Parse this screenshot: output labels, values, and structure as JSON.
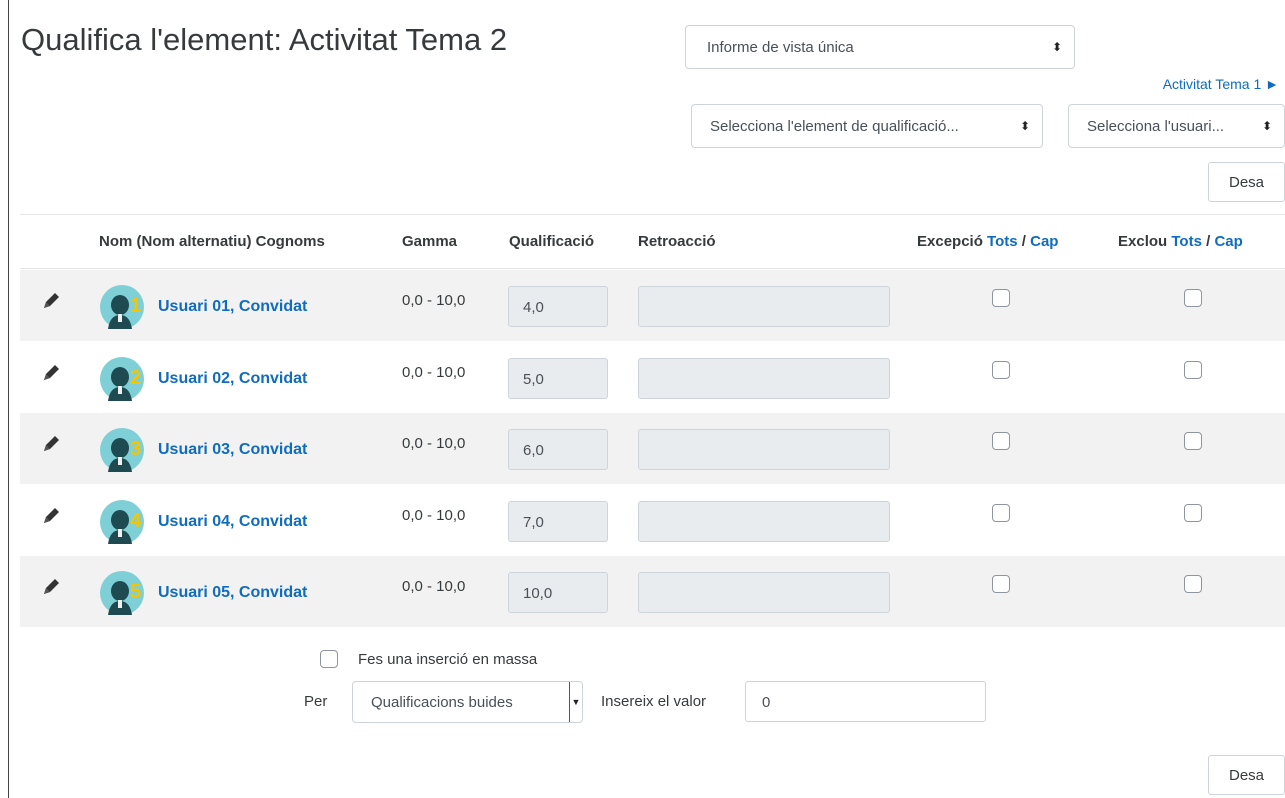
{
  "page": {
    "title": "Qualifica l'element: Activitat Tema 2"
  },
  "report_select": {
    "value": "Informe de vista única"
  },
  "next_item_link": {
    "label": "Activitat Tema 1 ►"
  },
  "item_select": {
    "value": "Selecciona l'element de qualificació..."
  },
  "user_select": {
    "value": "Selecciona l'usuari..."
  },
  "save_button": {
    "label": "Desa"
  },
  "table": {
    "headers": {
      "name": "Nom (Nom alternatiu) Cognoms",
      "range": "Gamma",
      "grade": "Qualificació",
      "feedback": "Retroacció",
      "override": "Excepció",
      "exclude": "Exclou",
      "all": "Tots",
      "none": "Cap",
      "sep": " / "
    },
    "rows": [
      {
        "name": "Usuari 01, Convidat",
        "avatar_number": "1",
        "range": "0,0 - 10,0",
        "grade": "4,0",
        "feedback": "",
        "override": false,
        "exclude": false
      },
      {
        "name": "Usuari 02, Convidat",
        "avatar_number": "2",
        "range": "0,0 - 10,0",
        "grade": "5,0",
        "feedback": "",
        "override": false,
        "exclude": false
      },
      {
        "name": "Usuari 03, Convidat",
        "avatar_number": "3",
        "range": "0,0 - 10,0",
        "grade": "6,0",
        "feedback": "",
        "override": false,
        "exclude": false
      },
      {
        "name": "Usuari 04, Convidat",
        "avatar_number": "4",
        "range": "0,0 - 10,0",
        "grade": "7,0",
        "feedback": "",
        "override": false,
        "exclude": false
      },
      {
        "name": "Usuari 05, Convidat",
        "avatar_number": "5",
        "range": "0,0 - 10,0",
        "grade": "10,0",
        "feedback": "",
        "override": false,
        "exclude": false
      }
    ]
  },
  "bulk": {
    "checkbox_label": "Fes una inserció en massa",
    "for_label": "Per",
    "for_select": "Qualificacions buides",
    "insert_label": "Insereix el valor",
    "insert_value": "0"
  },
  "colors": {
    "link": "#0f6cbf",
    "row_stripe": "#f2f2f2",
    "avatar_bg": "#7fd0d6",
    "avatar_number": "#f6c400"
  },
  "icons": {
    "edit": "pencil-icon",
    "dropdown": "sort-arrows-icon",
    "avatar": "user-avatar-icon"
  }
}
